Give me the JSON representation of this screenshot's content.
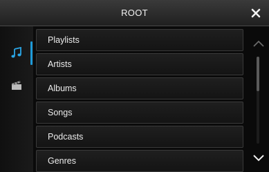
{
  "header": {
    "title": "ROOT",
    "close_icon": "close-icon"
  },
  "sidebar": {
    "tabs": [
      {
        "icon": "music-note-icon",
        "active": true
      },
      {
        "icon": "video-clapper-icon",
        "active": false
      }
    ],
    "accent_color": "#1e9ad8"
  },
  "list": {
    "items": [
      {
        "label": "Playlists"
      },
      {
        "label": "Artists"
      },
      {
        "label": "Albums"
      },
      {
        "label": "Songs"
      },
      {
        "label": "Podcasts"
      },
      {
        "label": "Genres"
      }
    ]
  },
  "scrollbar": {
    "up_icon": "chevron-up-icon",
    "down_icon": "chevron-down-icon",
    "thumb_fraction": 0.4,
    "position_fraction": 0.0
  }
}
